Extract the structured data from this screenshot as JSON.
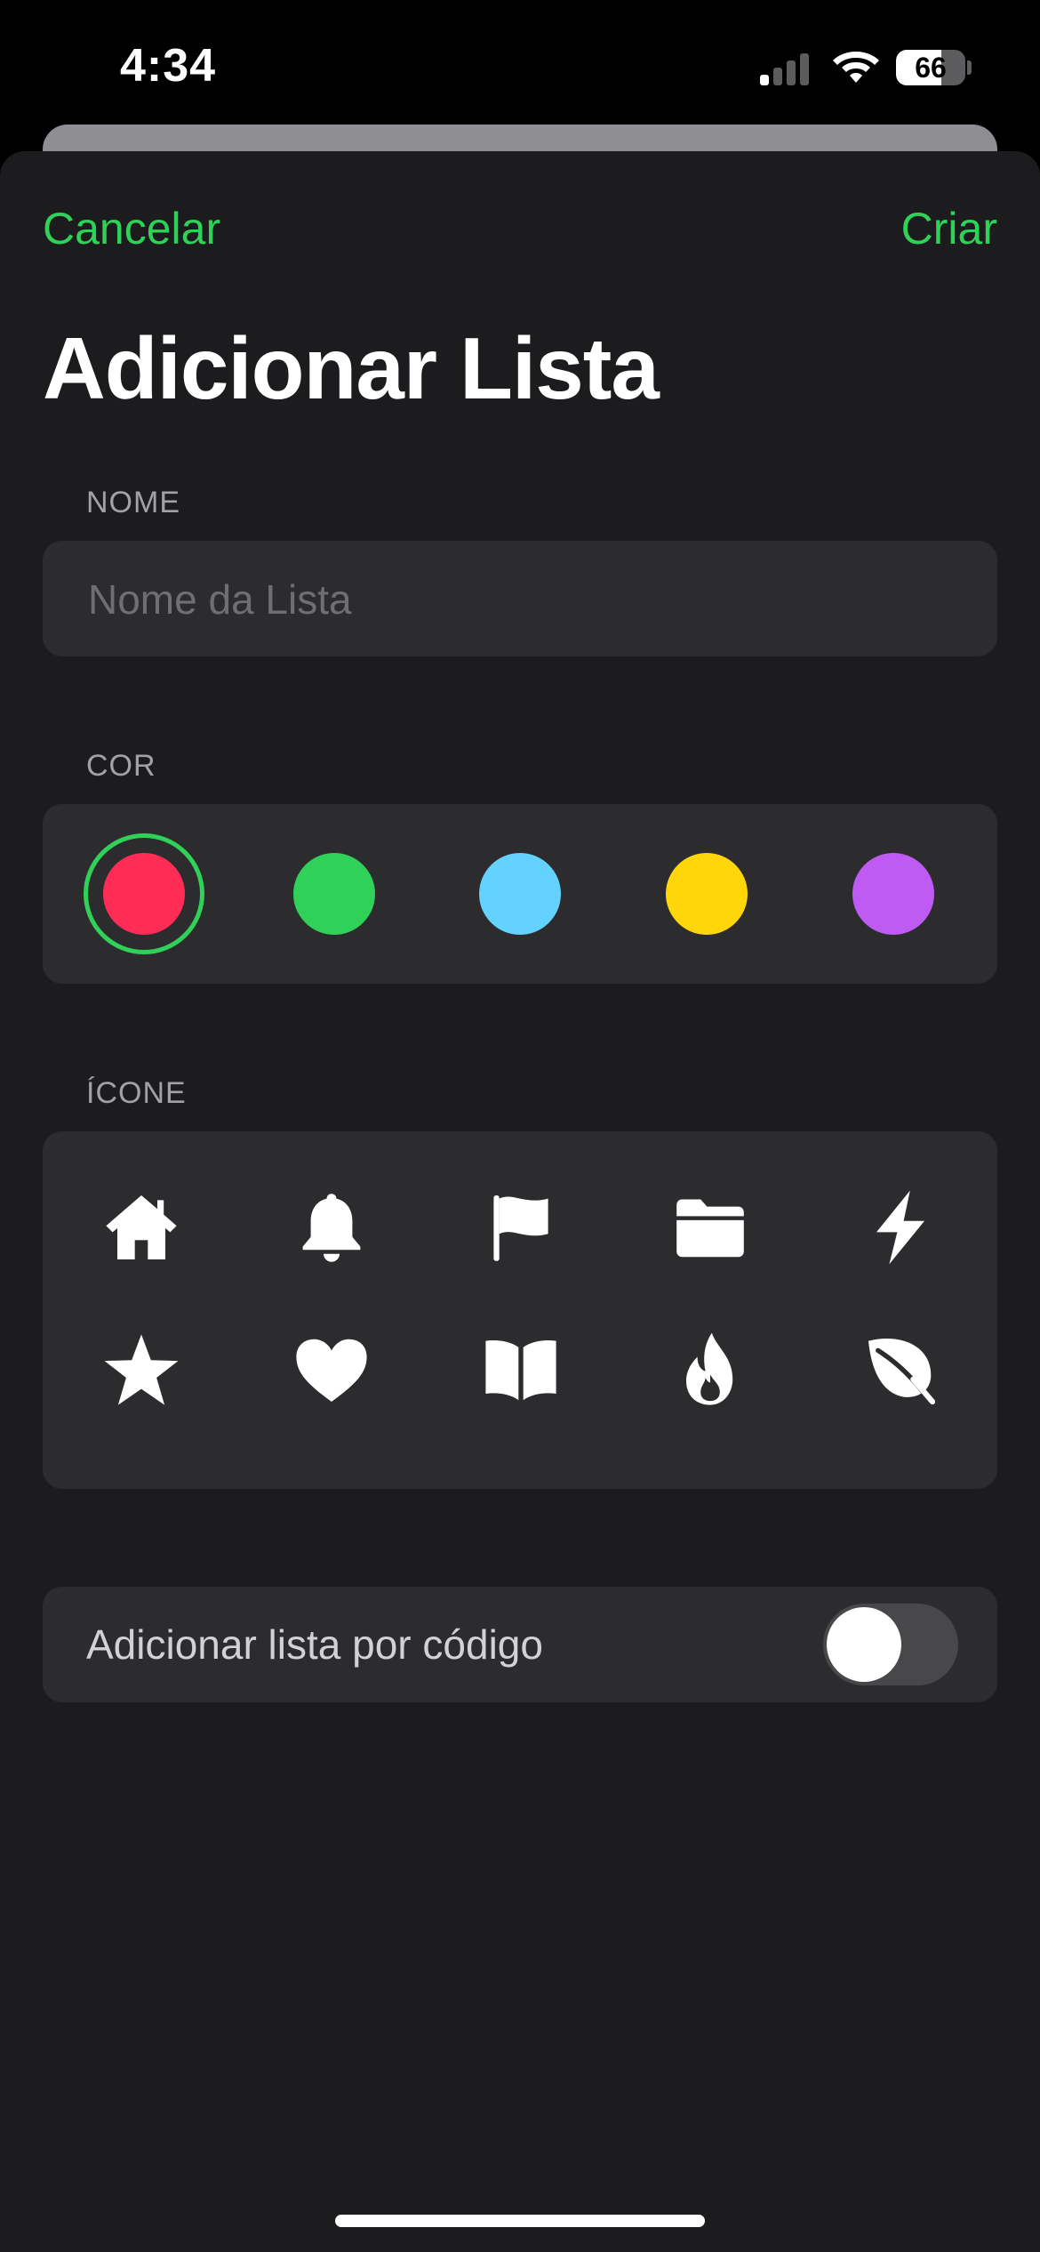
{
  "status_bar": {
    "time": "4:34",
    "battery_percent": 66,
    "battery_label": "66",
    "icons": [
      "cellular-signal-icon",
      "wifi-icon",
      "battery-icon"
    ]
  },
  "header": {
    "cancel_label": "Cancelar",
    "create_label": "Criar",
    "title": "Adicionar Lista"
  },
  "name_section": {
    "label": "NOME",
    "value": "",
    "placeholder": "Nome da Lista"
  },
  "color_section": {
    "label": "COR",
    "selected_index": 0,
    "colors": [
      "#ff2d55",
      "#30d158",
      "#64d2ff",
      "#ffd60a",
      "#bf5af2"
    ]
  },
  "icon_section": {
    "label": "ÍCONE",
    "icons": [
      "house-icon",
      "bell-icon",
      "flag-icon",
      "folder-icon",
      "bolt-icon",
      "star-icon",
      "heart-icon",
      "book-icon",
      "flame-icon",
      "leaf-icon"
    ]
  },
  "code_toggle": {
    "label": "Adicionar lista por código",
    "on": false
  },
  "colors": {
    "accent": "#30d158",
    "sheet_background": "#1c1c1e",
    "card_background": "#2c2c2e"
  }
}
